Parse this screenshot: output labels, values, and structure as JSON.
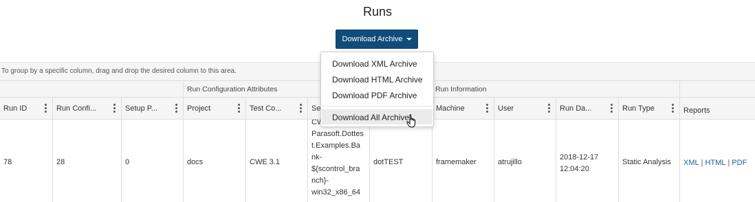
{
  "page": {
    "title": "Runs"
  },
  "toolbar": {
    "download_label": "Download Archive"
  },
  "download_menu": {
    "items": [
      "Download XML Archive",
      "Download HTML Archive",
      "Download PDF Archive",
      "Download All Archive"
    ]
  },
  "grid": {
    "group_hint": "To group by a specific column, drag and drop the desired column to this area.",
    "group_headers": {
      "run_config": "Run Configuration Attributes",
      "run_info": "Run Information"
    },
    "columns": [
      "Run ID",
      "Run Confi...",
      "Setup P...",
      "Project",
      "Test Co...",
      "Se",
      "",
      "Machine",
      "User",
      "Run Da...",
      "Run Type",
      "Reports"
    ],
    "row": {
      "run_id": "78",
      "run_config": "28",
      "setup": "0",
      "project": "docs",
      "test_config": "CWE 3.1",
      "session_lines": [
        "CWE 3.1-",
        "Parasoft.Dottes",
        "t.Examples.Ba",
        "nk-",
        "${scontrol_bra",
        "nch}-",
        "win32_x86_64"
      ],
      "tool": "dotTEST",
      "machine": "framemaker",
      "user": "atrujillo",
      "run_date_line1": "2018-12-17",
      "run_date_line2": "12:04:20",
      "run_type": "Static Analysis",
      "reports": {
        "xml": "XML",
        "html": "HTML",
        "pdf": "PDF",
        "sep": "|"
      }
    }
  },
  "colors": {
    "accent": "#0f4c7a",
    "link": "#1a5e96"
  }
}
